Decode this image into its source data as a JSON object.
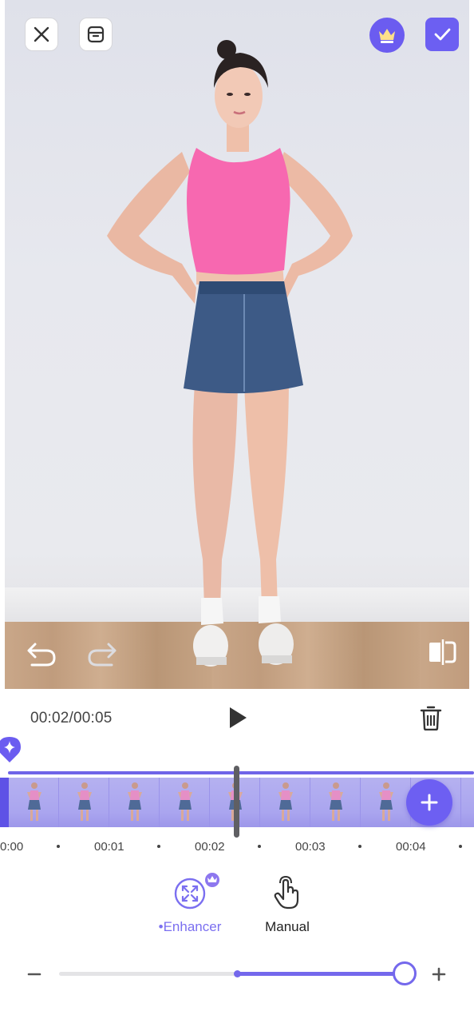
{
  "colors": {
    "accent": "#6c5ff2",
    "accent_light": "#7b6ff0",
    "timeline": "#8e86e9",
    "playhead": "#5f5f63"
  },
  "toolbar": {
    "close_icon": "close-icon",
    "archive_icon": "archive-icon",
    "premium_icon": "crown-icon",
    "confirm_icon": "check-icon"
  },
  "preview": {
    "undo_icon": "undo-icon",
    "redo_icon": "redo-icon",
    "compare_icon": "compare-icon"
  },
  "playback": {
    "time": "00:02/00:05",
    "play_icon": "play-icon",
    "delete_icon": "trash-icon"
  },
  "timeline": {
    "marker_icon": "sparkle-icon",
    "add_icon": "plus-icon",
    "frame_count": 10,
    "ticks": [
      "0:00",
      "00:01",
      "00:02",
      "00:03",
      "00:04"
    ]
  },
  "modes": {
    "enhancer_label": "•Enhancer",
    "manual_label": "Manual",
    "enhancer_icon": "expand-arrows-icon",
    "manual_icon": "hand-pointer-icon",
    "vip_icon": "crown-badge-icon"
  },
  "strength": {
    "minus_label": "–",
    "plus_label": "+",
    "value_fraction": 1.0
  }
}
